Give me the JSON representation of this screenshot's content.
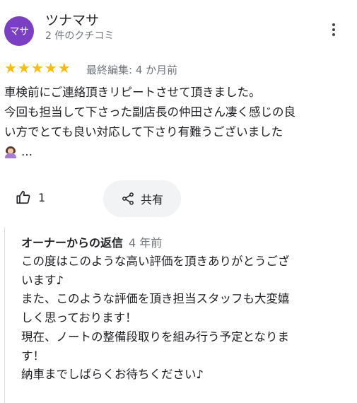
{
  "author": {
    "avatar_text": "マサ",
    "avatar_color": "#7b3fc4",
    "name": "ツナマサ",
    "meta": "2 件のクチコミ"
  },
  "rating": {
    "stars": 5,
    "star_glyphs": "★★★★★",
    "edited": "最終編集: 4 か月前"
  },
  "review": {
    "lines": [
      "車検前にご連絡頂きリピートさせて頂きました。",
      "今回も担当して下さった副店長の仲田さん凄く感じの良",
      "い方でとても良い対応して下さり有難うございました"
    ],
    "emoji_icon": "woman-emoji-icon",
    "ellipsis": "…"
  },
  "actions": {
    "like_count": "1",
    "share_label": "共有"
  },
  "reply": {
    "owner_label": "オーナーからの返信",
    "time": "4 年前",
    "lines": [
      "この度はこのような高い評価を頂きありがとうござ",
      "います♪",
      "また、このような評価を頂き担当スタッフも大変嬉",
      "しく思っております！",
      "現在、ノートの整備段取りを組み行う予定となりま",
      "す！",
      "納車までしばらくお待ちください♪"
    ]
  },
  "colors": {
    "star": "#fbbc04",
    "muted_text": "#70757a",
    "share_bg": "#f1f3f4"
  }
}
